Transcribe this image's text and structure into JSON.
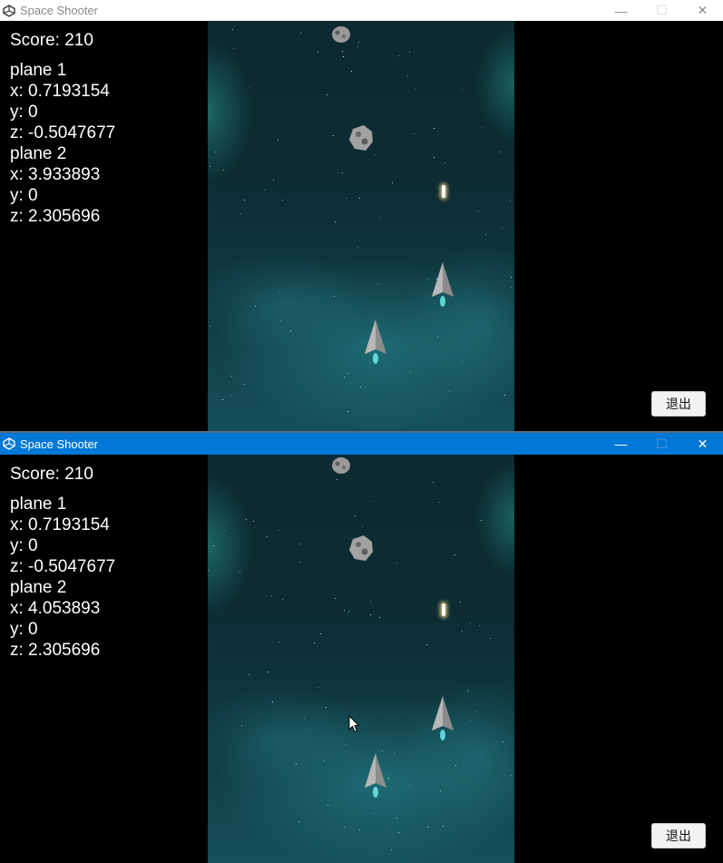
{
  "windows": [
    {
      "title": "Space Shooter",
      "state": "inactive",
      "hud": {
        "score": "Score: 210",
        "plane1_label": "plane 1",
        "plane1_x": "x: 0.7193154",
        "plane1_y": "y: 0",
        "plane1_z": "z: -0.5047677",
        "plane2_label": "plane 2",
        "plane2_x": "x: 3.933893",
        "plane2_y": "y: 0",
        "plane2_z": "z: 2.305696"
      },
      "exit_label": "退出"
    },
    {
      "title": "Space Shooter",
      "state": "active",
      "hud": {
        "score": "Score: 210",
        "plane1_label": "plane 1",
        "plane1_x": "x: 0.7193154",
        "plane1_y": "y: 0",
        "plane1_z": "z: -0.5047677",
        "plane2_label": "plane 2",
        "plane2_x": "x: 4.053893",
        "plane2_y": "y: 0",
        "plane2_z": "z: 2.305696"
      },
      "exit_label": "退出"
    }
  ],
  "colors": {
    "active_titlebar": "#0078d7",
    "inactive_titlebar": "#ffffff",
    "hud_text": "#ffffff",
    "background": "#000000"
  },
  "icons": {
    "app": "unity-logo-icon",
    "minimize": "minimize-icon",
    "maximize": "maximize-icon",
    "close": "close-icon",
    "cursor": "mouse-pointer-icon"
  }
}
